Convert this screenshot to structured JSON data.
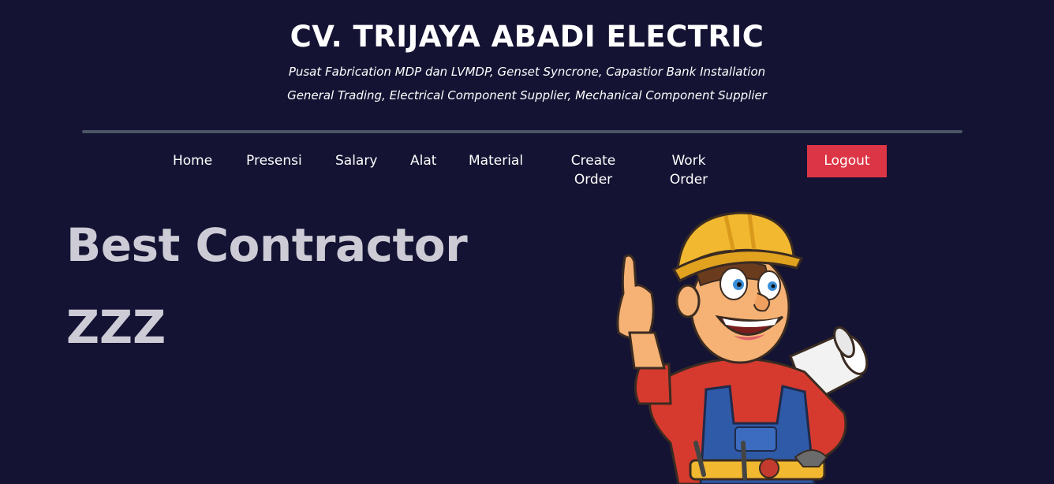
{
  "header": {
    "company_name": "CV. TRIJAYA ABADI ELECTRIC",
    "tagline_1": "Pusat Fabrication MDP dan LVMDP, Genset Syncrone, Capastior Bank Installation",
    "tagline_2": "General Trading, Electrical Component Supplier, Mechanical Component Supplier"
  },
  "nav": {
    "home": "Home",
    "presensi": "Presensi",
    "salary": "Salary",
    "alat": "Alat",
    "material": "Material",
    "create_order_1": "Create",
    "create_order_2": "Order",
    "work_order_1": "Work",
    "work_order_2": "Order",
    "logout": "Logout"
  },
  "hero": {
    "title": "Best Contractor",
    "subtitle": "ZZZ"
  },
  "colors": {
    "background": "#141333",
    "logout_button": "#dc3545",
    "hero_text": "#cdccd6",
    "divider": "#4a5466"
  },
  "icons": {
    "mascot": "construction-worker-thumbs-up-illustration"
  }
}
